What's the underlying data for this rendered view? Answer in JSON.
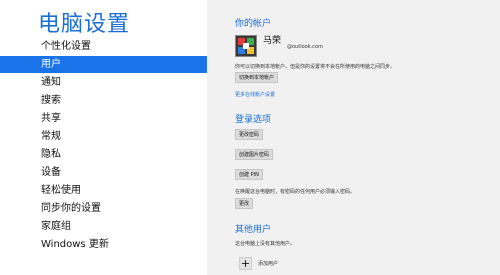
{
  "app": {
    "title": "电脑设置"
  },
  "nav": {
    "items": [
      {
        "label": "个性化设置"
      },
      {
        "label": "用户",
        "selected": true
      },
      {
        "label": "通知"
      },
      {
        "label": "搜索"
      },
      {
        "label": "共享"
      },
      {
        "label": "常规"
      },
      {
        "label": "隐私"
      },
      {
        "label": "设备"
      },
      {
        "label": "轻松使用"
      },
      {
        "label": "同步你的设置"
      },
      {
        "label": "家庭组"
      },
      {
        "label": "Windows 更新"
      }
    ]
  },
  "account": {
    "section_title": "你的帐户",
    "user_name": "马荣",
    "user_email": "@outlook.com",
    "description": "你可以切换到本地帐户，但是你的设置将不会在所使用的电脑之间同步。",
    "switch_local_label": "切换到本地帐户",
    "more_settings_link": "更多在线帐户设置"
  },
  "signin": {
    "section_title": "登录选项",
    "change_password_label": "更改密码",
    "create_picture_password_label": "创建图片密码",
    "create_pin_label": "创建 PIN",
    "wake_description": "在唤醒这台电脑时，有密码的任何用户必须输入密码。",
    "change_label": "更改"
  },
  "other_users": {
    "section_title": "其他用户",
    "description": "这台电脑上没有其他用户。",
    "add_user_label": "添加用户",
    "add_icon_glyph": "+"
  },
  "colors": {
    "accent": "#1a73e8",
    "right_pane": "#f1f1f1"
  }
}
